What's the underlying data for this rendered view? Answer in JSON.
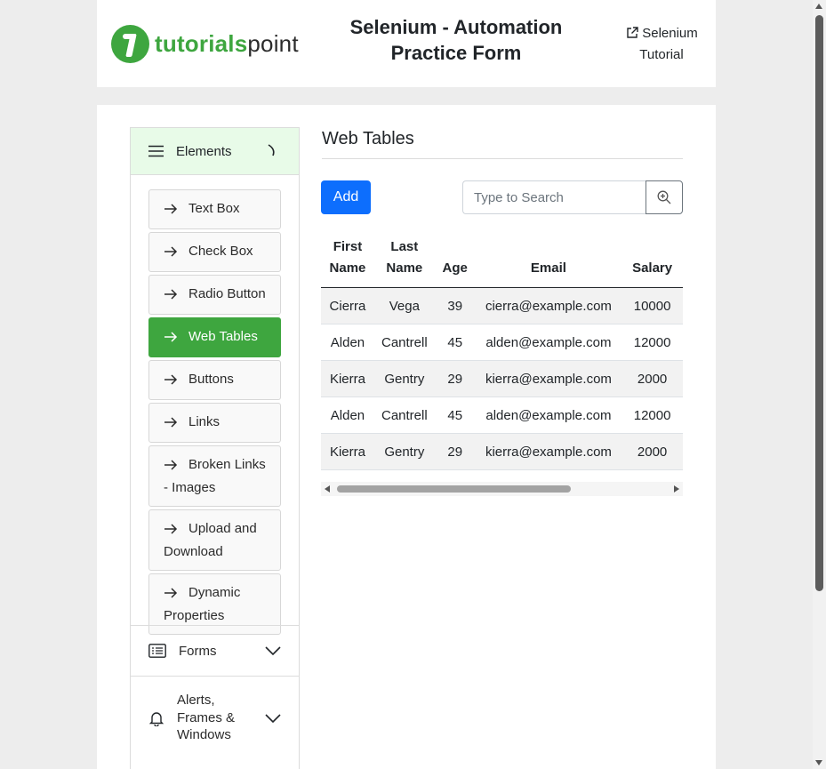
{
  "header": {
    "logo_part1": "tutorials",
    "logo_part2": "point",
    "title_line1": "Selenium - Automation",
    "title_line2": "Practice Form",
    "link_line1": "Selenium",
    "link_line2": "Tutorial"
  },
  "sidebar": {
    "elements_label": "Elements",
    "items": [
      {
        "label": "Text Box"
      },
      {
        "label": "Check Box"
      },
      {
        "label": "Radio Button"
      },
      {
        "label": "Web Tables"
      },
      {
        "label": "Buttons"
      },
      {
        "label": "Links"
      },
      {
        "label": "Broken Links - Images"
      },
      {
        "label": "Upload and Download"
      },
      {
        "label": "Dynamic Properties"
      }
    ],
    "active_item": "Web Tables",
    "forms_label": "Forms",
    "alerts_label": "Alerts, Frames & Windows"
  },
  "main": {
    "title": "Web Tables",
    "add_label": "Add",
    "search_placeholder": "Type to Search",
    "table": {
      "headers": [
        "First Name",
        "Last Name",
        "Age",
        "Email",
        "Salary"
      ],
      "rows": [
        [
          "Cierra",
          "Vega",
          "39",
          "cierra@example.com",
          "10000"
        ],
        [
          "Alden",
          "Cantrell",
          "45",
          "alden@example.com",
          "12000"
        ],
        [
          "Kierra",
          "Gentry",
          "29",
          "kierra@example.com",
          "2000"
        ],
        [
          "Alden",
          "Cantrell",
          "45",
          "alden@example.com",
          "12000"
        ],
        [
          "Kierra",
          "Gentry",
          "29",
          "kierra@example.com",
          "2000"
        ]
      ]
    }
  },
  "colors": {
    "brand_green": "#3ea63f",
    "primary_blue": "#0d6efd",
    "accordion_active_bg": "#e8fbe8"
  },
  "icons": {
    "menu": "hamburger-icon",
    "item_arrow": "arrow-right-icon",
    "forms": "list-icon",
    "alerts": "bell-icon",
    "search": "zoom-in-icon",
    "external": "external-link-icon"
  }
}
